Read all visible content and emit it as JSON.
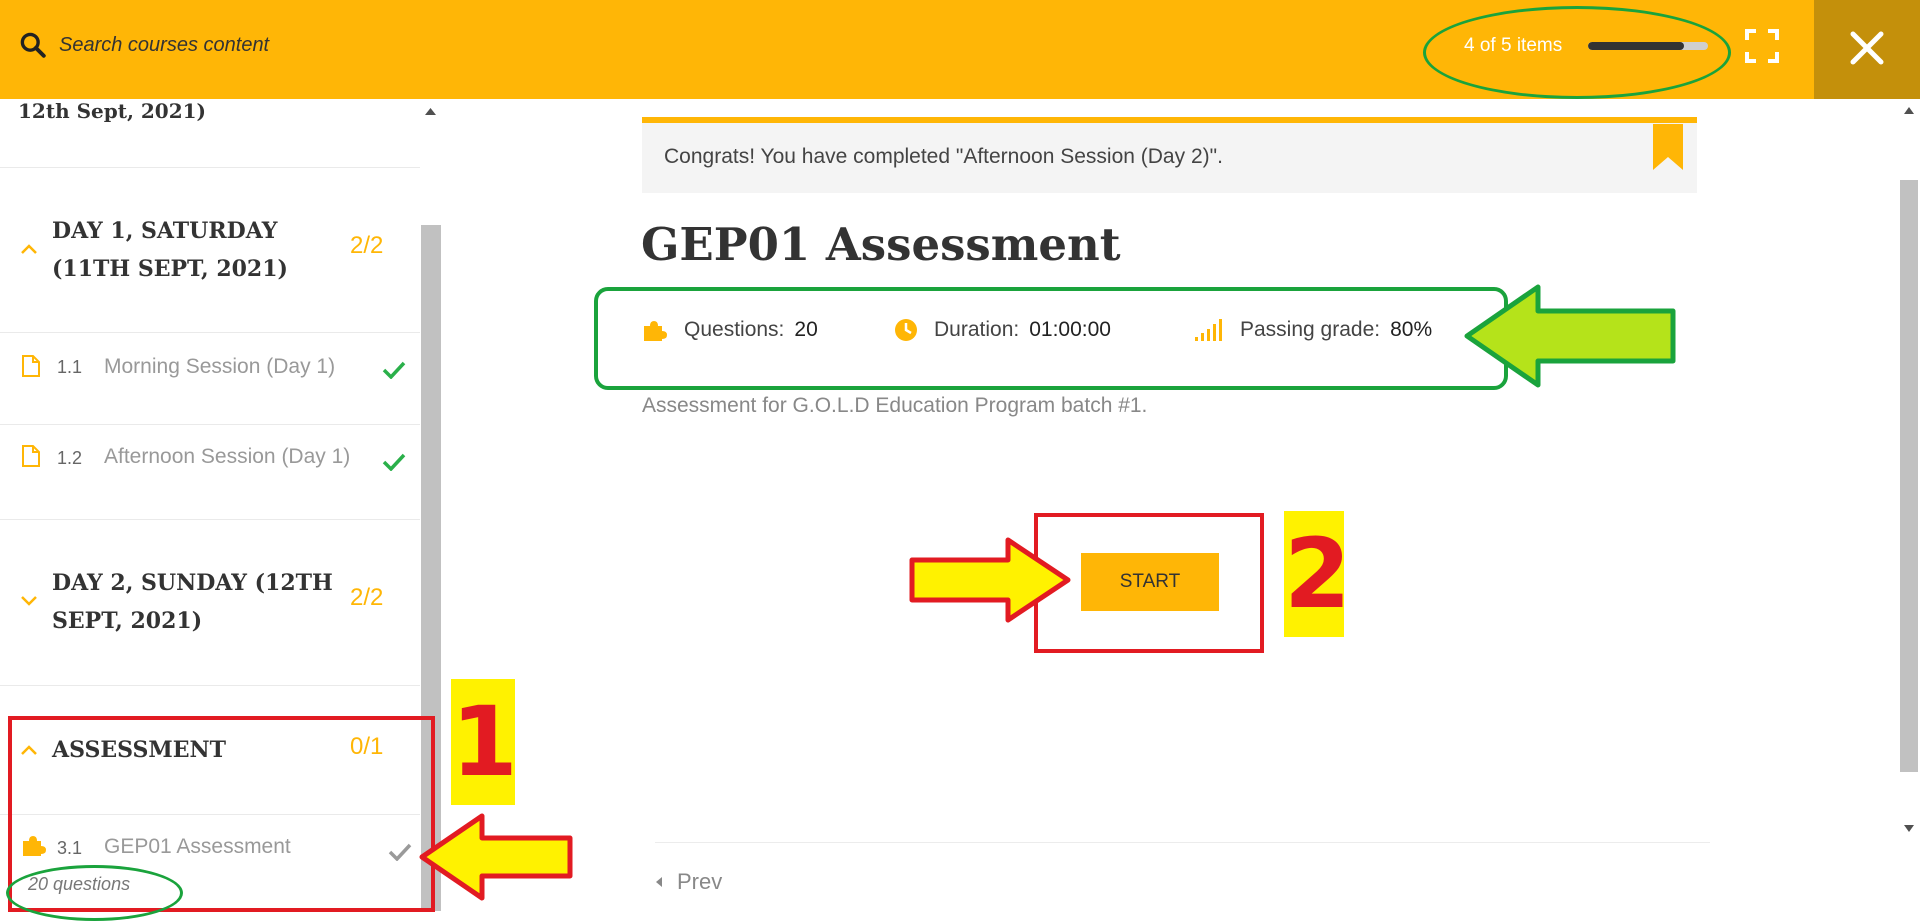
{
  "header": {
    "search_placeholder": "Search courses content",
    "progress_text": "4 of 5 items",
    "progress_fraction": 0.8
  },
  "sidebar": {
    "header_text": "12th Sept, 2021)",
    "sections": [
      {
        "title": "DAY 1, SATURDAY (11TH SEPT, 2021)",
        "count": "2/2",
        "items": [
          {
            "num": "1.1",
            "title": "Morning Session (Day 1)"
          },
          {
            "num": "1.2",
            "title": "Afternoon Session (Day 1)"
          }
        ]
      },
      {
        "title": "DAY 2, SUNDAY (12TH SEPT, 2021)",
        "count": "2/2",
        "items": []
      },
      {
        "title": "ASSESSMENT",
        "count": "0/1",
        "items": [
          {
            "num": "3.1",
            "title": "GEP01 Assessment",
            "sub": "20 questions"
          }
        ]
      }
    ]
  },
  "main": {
    "notice": "Congrats! You have completed \"Afternoon Session (Day 2)\".",
    "title": "GEP01 Assessment",
    "meta": {
      "questions_label": "Questions:",
      "questions_value": "20",
      "duration_label": "Duration:",
      "duration_value": "01:00:00",
      "passing_label": "Passing grade:",
      "passing_value": "80%"
    },
    "description": "Assessment for G.O.L.D Education Program batch #1.",
    "start_label": "START",
    "prev_label": "Prev"
  },
  "annotations": {
    "label_1": "1",
    "label_2": "2"
  },
  "colors": {
    "accent": "#ffb606",
    "header_dark": "#c4900b",
    "annotation_red": "#e21b22",
    "annotation_green": "#1aa33c",
    "annotation_yellow": "#fff200",
    "check_green": "#2ab04a"
  }
}
